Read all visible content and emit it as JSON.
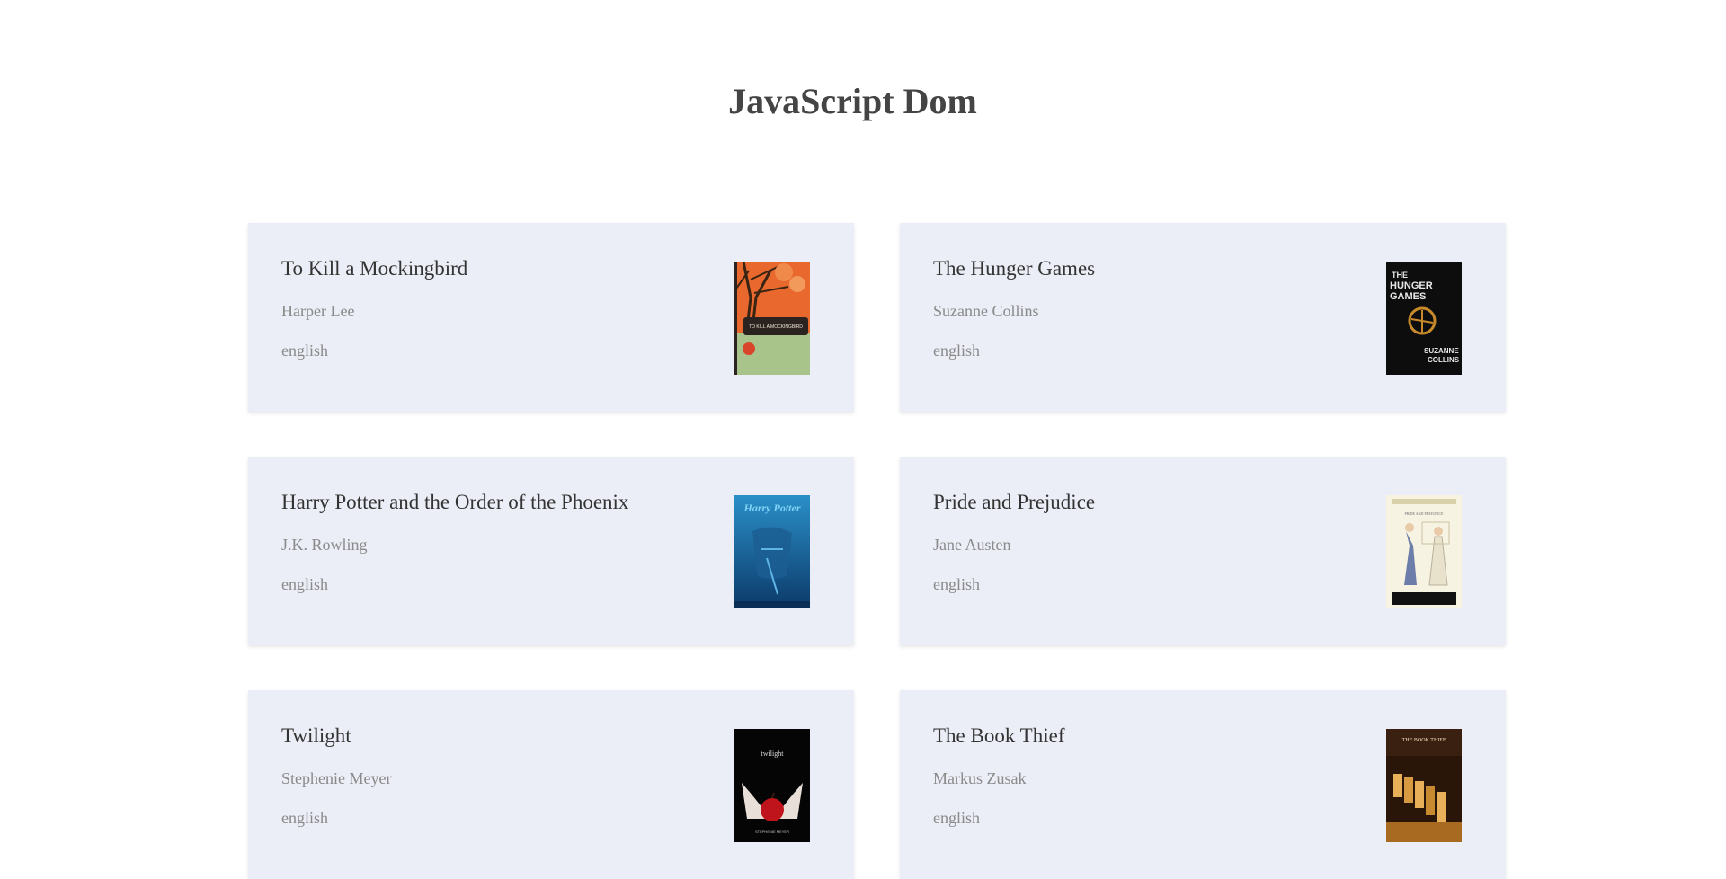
{
  "header": {
    "title": "JavaScript Dom"
  },
  "books": [
    {
      "title": "To Kill a Mockingbird",
      "author": "Harper Lee",
      "language": "english",
      "cover_icon": "mockingbird-cover",
      "cover_text": "TO KILL A MOCKINGBIRD"
    },
    {
      "title": "The Hunger Games",
      "author": "Suzanne Collins",
      "language": "english",
      "cover_icon": "hunger-games-cover",
      "cover_text": "THE HUNGER GAMES",
      "cover_text_bottom": "SUZANNE COLLINS"
    },
    {
      "title": "Harry Potter and the Order of the Phoenix",
      "author": "J.K. Rowling",
      "language": "english",
      "cover_icon": "harry-potter-cover",
      "cover_text": "Harry Potter"
    },
    {
      "title": "Pride and Prejudice",
      "author": "Jane Austen",
      "language": "english",
      "cover_icon": "pride-prejudice-cover",
      "cover_text": "PRIDE AND PREJUDICE"
    },
    {
      "title": "Twilight",
      "author": "Stephenie Meyer",
      "language": "english",
      "cover_icon": "twilight-cover",
      "cover_text": "twilight",
      "cover_text_bottom": "STEPHENIE MEYER"
    },
    {
      "title": "The Book Thief",
      "author": "Markus Zusak",
      "language": "english",
      "cover_icon": "book-thief-cover",
      "cover_text": "THE BOOK THIEF"
    }
  ],
  "colors": {
    "card_background": "#eceef7",
    "title_text": "#333333",
    "muted_text": "#8a8a8a",
    "heading_text": "#444444"
  }
}
